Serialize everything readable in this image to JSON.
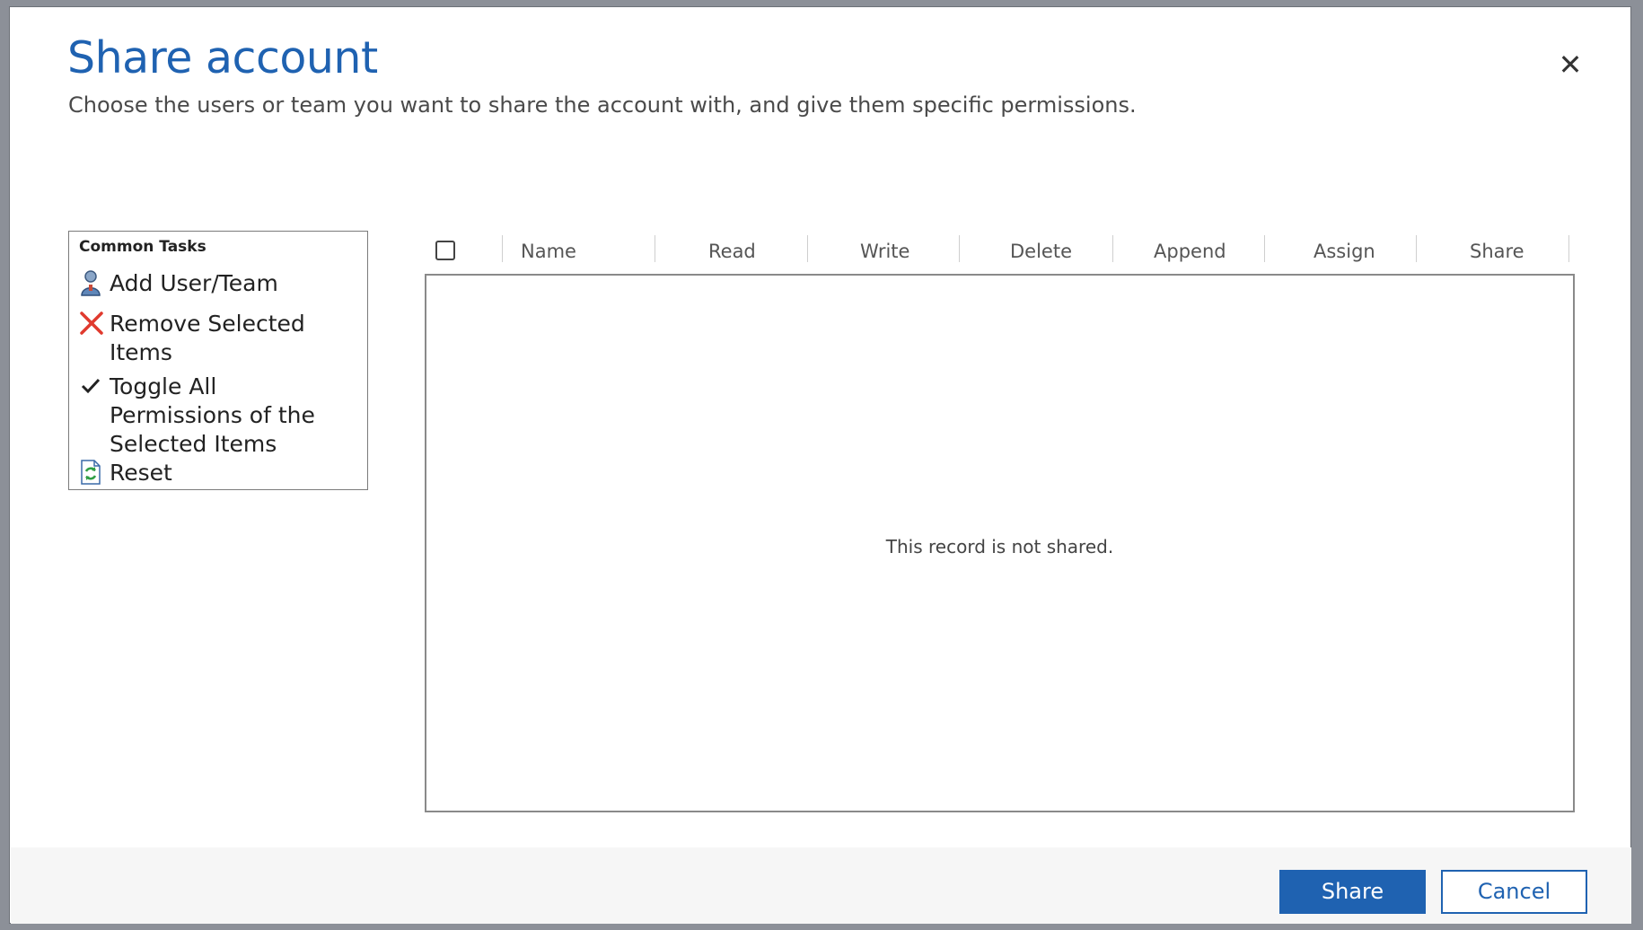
{
  "dialog": {
    "title": "Share account",
    "subtitle": "Choose the users or team you want to share the account with, and give them specific permissions.",
    "close_icon": "close-icon"
  },
  "tasks": {
    "title": "Common Tasks",
    "items": [
      {
        "label": "Add User/Team",
        "icon": "user-icon"
      },
      {
        "label": "Remove Selected Items",
        "icon": "red-x-icon"
      },
      {
        "label": "Toggle All Permissions of the Selected Items",
        "icon": "checkmark-icon"
      },
      {
        "label": "Reset",
        "icon": "reset-icon"
      }
    ]
  },
  "grid": {
    "columns": [
      "Name",
      "Read",
      "Write",
      "Delete",
      "Append",
      "Assign",
      "Share"
    ],
    "empty_message": "This record is not shared."
  },
  "footer": {
    "primary_label": "Share",
    "secondary_label": "Cancel"
  },
  "colors": {
    "accent": "#1f62b1",
    "remove": "#e03a2e"
  }
}
